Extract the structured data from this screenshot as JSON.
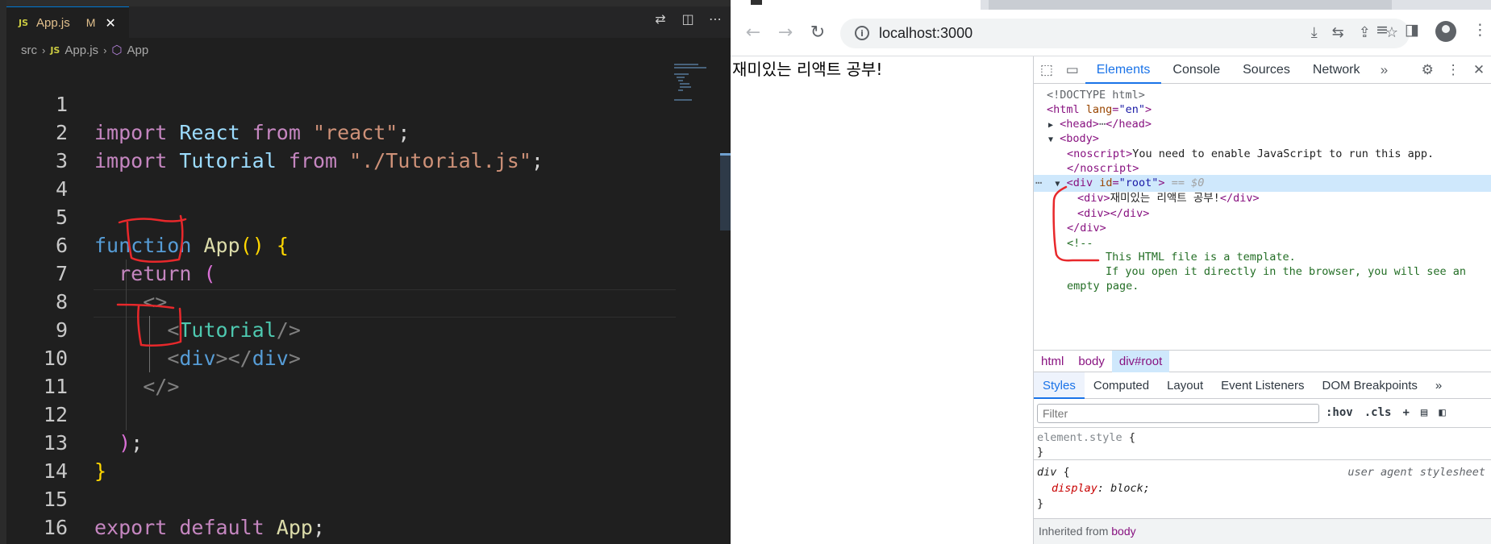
{
  "vscode": {
    "tab": {
      "badge": "JS",
      "filename": "App.js",
      "status": "M",
      "close": "✕"
    },
    "toolbar_icons": [
      "source-control-icon",
      "split-editor-icon",
      "more-icon"
    ],
    "breadcrumb": {
      "folder": "src",
      "badge": "JS",
      "file": "App.js",
      "symbol": "App"
    },
    "lines": [
      "1",
      "2",
      "3",
      "4",
      "5",
      "6",
      "7",
      "8",
      "9",
      "10",
      "11",
      "12",
      "13",
      "14",
      "15",
      "16"
    ],
    "code": {
      "l1": {
        "kw": "import",
        "name": "React",
        "from": "from",
        "str": "\"react\"",
        "semi": ";"
      },
      "l2": {
        "kw": "import",
        "name": "Tutorial",
        "from": "from",
        "str": "\"./Tutorial.js\"",
        "semi": ";"
      },
      "l5": {
        "kw": "function",
        "name": "App",
        "parens": "()",
        "brace": "{"
      },
      "l6": {
        "kw": "return",
        "paren": "("
      },
      "l7": {
        "frag": "<>"
      },
      "l8": {
        "lt": "<",
        "tag": "Tutorial",
        "end": "/>"
      },
      "l9": {
        "lt": "<",
        "tag": "div",
        "mid": "></",
        "tag2": "div",
        "gt": ">"
      },
      "l10": {
        "frag": "</>"
      },
      "l12": {
        "paren": ")",
        "semi": ";"
      },
      "l13": {
        "brace": "}"
      },
      "l15": {
        "kw": "export",
        "kw2": "default",
        "name": "App",
        "semi": ";"
      }
    }
  },
  "chrome": {
    "url": "localhost:3000",
    "page_text": "재미있는 리액트 공부!",
    "devtools": {
      "tabs": [
        "Elements",
        "Console",
        "Sources",
        "Network"
      ],
      "more": "»",
      "dom": {
        "doctype": "<!DOCTYPE html>",
        "html_open": "<html",
        "html_attr": "lang",
        "html_val": "\"en\"",
        "head": "<head>",
        "head_close": "</head>",
        "body": "<body>",
        "noscript_open": "<noscript>",
        "noscript_text": "You need to enable JavaScript to run this app.",
        "noscript_close": "</noscript>",
        "root_open": "<div",
        "root_attr": "id",
        "root_val": "\"root\"",
        "root_gt": ">",
        "sel_marker": "== $0",
        "div1_open": "<div>",
        "div1_text": "재미있는 리액트 공부!",
        "div1_close": "</div>",
        "div2": "<div></div>",
        "root_close": "</div>",
        "comment_open": "<!--",
        "comment1": "This HTML file is a template.",
        "comment2": "If you open it directly in the browser, you will see an",
        "comment3": "empty page."
      },
      "crumbs": [
        "html",
        "body",
        "div#root"
      ],
      "subtabs": [
        "Styles",
        "Computed",
        "Layout",
        "Event Listeners",
        "DOM Breakpoints"
      ],
      "filter_placeholder": "Filter",
      "filter_actions": [
        ":hov",
        ".cls",
        "+"
      ],
      "rules": {
        "element_style": "element.style",
        "brace_open": "{",
        "brace_close": "}",
        "div_selector": "div",
        "div_source": "user agent stylesheet",
        "prop": "display",
        "value": "block;"
      },
      "inherited_label": "Inherited from",
      "inherited_tag": "body"
    }
  },
  "colors": {
    "annotation_red": "#e8282b",
    "vscode_bg": "#1f1f1f",
    "selection_blue": "#cfe8fc",
    "accent": "#1a73e8"
  }
}
